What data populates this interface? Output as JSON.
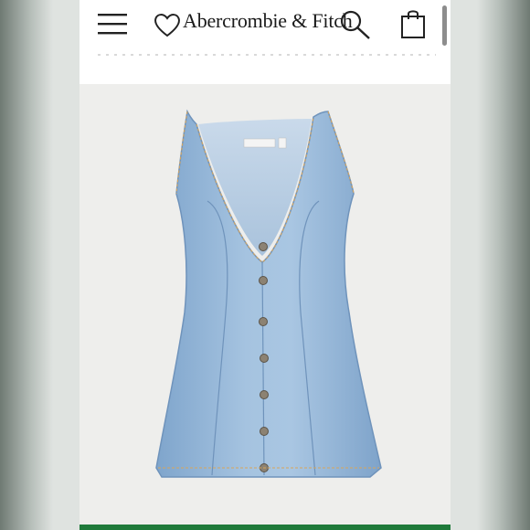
{
  "header": {
    "brand": "Abercrombie & Fitch",
    "icons": [
      "menu-icon",
      "heart-icon",
      "search-icon",
      "shopping-bag-icon"
    ]
  },
  "product": {
    "image_description": "light-wash denim sleeveless V-neck button-front mini dress",
    "image_icon": "denim-dress-image"
  },
  "colors": {
    "denim": "#93b6d8",
    "background": "#eeeeec",
    "accent_bar": "#1f7a3a"
  }
}
